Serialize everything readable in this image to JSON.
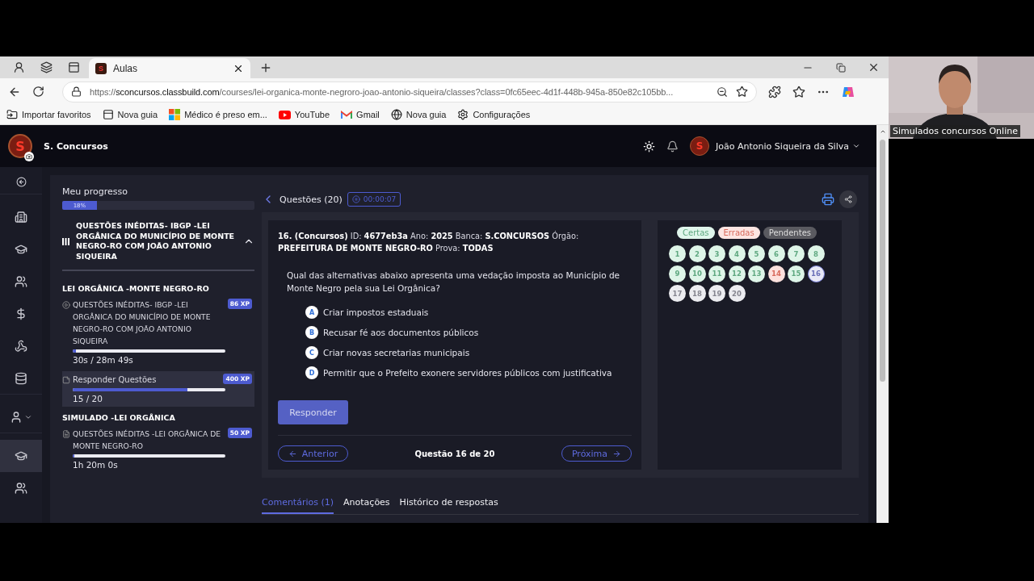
{
  "window": {
    "tabs": [
      {
        "title": "Aulas",
        "favicon_letter": "S",
        "selected": true
      }
    ],
    "url": {
      "scheme": "https://",
      "host": "sconcursos.classbuild.com",
      "rest": "/courses/lei-organica-monte-negroro-joao-antonio-siqueira/classes?class=0fc65eec-4d1f-448b-945a-850e82c105bb..."
    }
  },
  "bookmarks": [
    {
      "kind": "import",
      "label": "Importar favoritos"
    },
    {
      "kind": "tab",
      "label": "Nova guia"
    },
    {
      "kind": "windows",
      "label": "Médico é preso em..."
    },
    {
      "kind": "youtube",
      "label": "YouTube"
    },
    {
      "kind": "gmail",
      "label": "Gmail"
    },
    {
      "kind": "globe",
      "label": "Nova guia"
    },
    {
      "kind": "settings",
      "label": "Configurações"
    }
  ],
  "app": {
    "logo_letter": "S",
    "brand": "S. Concursos",
    "avatar_letter": "S",
    "user": "João Antonio Siqueira da Silva"
  },
  "rail": [
    {
      "kind": "back",
      "selected": false
    },
    {
      "kind": "building",
      "selected": false
    },
    {
      "kind": "cap",
      "selected": false
    },
    {
      "kind": "users",
      "selected": false
    },
    {
      "kind": "dollar",
      "selected": false
    },
    {
      "kind": "webhook",
      "selected": false
    },
    {
      "kind": "database",
      "selected": false
    },
    {
      "kind": "account",
      "selected": false
    },
    {
      "kind": "cap",
      "selected": true
    },
    {
      "kind": "team",
      "selected": false
    }
  ],
  "progress": {
    "label": "Meu progresso",
    "level": 0.18,
    "reading": "18%"
  },
  "course": {
    "title": "QUESTÕES INÉDITAS- IBGP -LEI ORGÂNICA DO MUNICÍPIO DE MONTE NEGRO-RO COM JOÃO ANTONIO SIQUEIRA",
    "expanded": true
  },
  "sections": [
    {
      "title": "LEI ORGÂNICA -MONTE NEGRO-RO",
      "lessons": [
        {
          "kind": "video",
          "title": "QUESTÕES INÉDITAS- IBGP -LEI ORGÂNICA DO MUNICÍPIO DE MONTE NEGRO-RO COM JOÃO ANTONIO SIQUEIRA",
          "xp": "86 XP",
          "level": 0.02,
          "reading": "30s / 28m 49s",
          "selected": false
        },
        {
          "kind": "quiz",
          "title": "Responder Questões",
          "xp": "400 XP",
          "level": 0.75,
          "reading": "15 / 20",
          "selected": true
        }
      ]
    },
    {
      "title": "SIMULADO -LEI ORGÂNICA",
      "lessons": [
        {
          "kind": "document",
          "title": "QUESTÕES INÉDITAS -LEI ORGÂNICA DE MONTE NEGRO-RO",
          "xp": "50 XP",
          "level": 0.01,
          "reading": "1h 20m 0s",
          "selected": false
        }
      ]
    }
  ],
  "question": {
    "title": "Questões (20)",
    "timer": "00:00:07",
    "meta": "**16. (Concursos)** ID: **4677eb3a** Ano: **2025** Banca: **S.CONCURSOS** Órgão: **PREFEITURA DE MONTE NEGRO-RO** Prova: **TODAS**",
    "text": "Qual das alternativas abaixo apresenta uma vedação imposta ao Município de Monte Negro pela sua Lei Orgânica?",
    "options": [
      {
        "letter": "A",
        "text": "Criar impostos estaduais"
      },
      {
        "letter": "B",
        "text": "Recusar fé aos documentos públicos"
      },
      {
        "letter": "C",
        "text": "Criar novas secretarias municipais"
      },
      {
        "letter": "D",
        "text": "Permitir que o Prefeito exonere servidores públicos com justificativa"
      }
    ],
    "submit": "Responder",
    "previous": "Anterior",
    "counter": "Questão 16 de 20",
    "next": "Próxima"
  },
  "legend": [
    {
      "kind": "correct",
      "label": "Certas"
    },
    {
      "kind": "wrong",
      "label": "Erradas"
    },
    {
      "kind": "pending",
      "label": "Pendentes"
    }
  ],
  "grid": [
    {
      "number": "1",
      "kind": "correct"
    },
    {
      "number": "2",
      "kind": "correct"
    },
    {
      "number": "3",
      "kind": "correct"
    },
    {
      "number": "4",
      "kind": "correct"
    },
    {
      "number": "5",
      "kind": "correct"
    },
    {
      "number": "6",
      "kind": "correct"
    },
    {
      "number": "7",
      "kind": "correct"
    },
    {
      "number": "8",
      "kind": "correct"
    },
    {
      "number": "9",
      "kind": "correct"
    },
    {
      "number": "10",
      "kind": "correct"
    },
    {
      "number": "11",
      "kind": "correct"
    },
    {
      "number": "12",
      "kind": "correct"
    },
    {
      "number": "13",
      "kind": "correct"
    },
    {
      "number": "14",
      "kind": "wrong"
    },
    {
      "number": "15",
      "kind": "correct"
    },
    {
      "number": "16",
      "kind": "current"
    },
    {
      "number": "17",
      "kind": "unanswered"
    },
    {
      "number": "18",
      "kind": "unanswered"
    },
    {
      "number": "19",
      "kind": "unanswered"
    },
    {
      "number": "20",
      "kind": "unanswered"
    }
  ],
  "tabs": [
    {
      "label": "Comentários (1)",
      "selected": true
    },
    {
      "label": "Anotações",
      "selected": false
    },
    {
      "label": "Histórico de respostas",
      "selected": false
    }
  ],
  "webcam": {
    "caption": "Simulados concursos Online"
  }
}
